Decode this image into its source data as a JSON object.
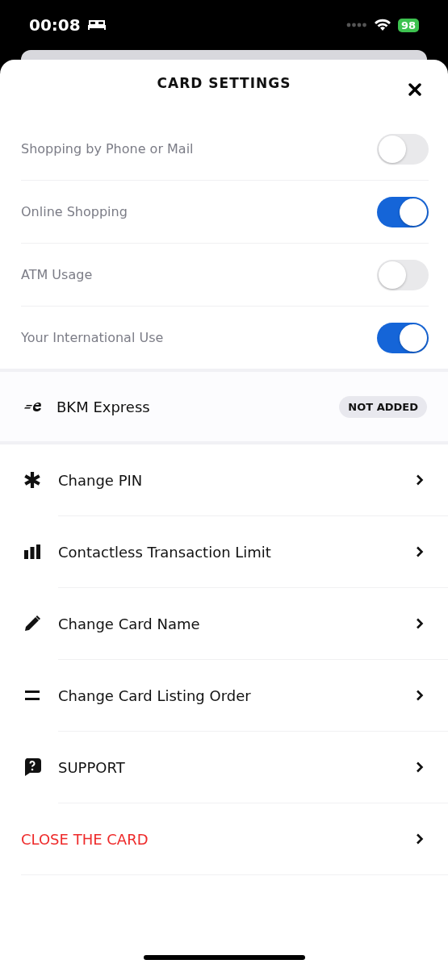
{
  "status_bar": {
    "time": "00:08",
    "battery": "98"
  },
  "title": "CARD SETTINGS",
  "toggles": [
    {
      "label": "Shopping by Phone or Mail",
      "on": false
    },
    {
      "label": "Online Shopping",
      "on": true
    },
    {
      "label": "ATM Usage",
      "on": false
    },
    {
      "label": "Your International Use",
      "on": true
    }
  ],
  "bkm": {
    "label": "BKM Express",
    "badge": "NOT ADDED"
  },
  "menu": [
    {
      "label": "Change PIN",
      "kind": "link"
    },
    {
      "label": "Contactless Transaction Limit",
      "kind": "link"
    },
    {
      "label": "Change Card Name",
      "kind": "link"
    },
    {
      "label": "Change Card Listing Order",
      "kind": "link"
    },
    {
      "label": "SUPPORT",
      "kind": "link"
    },
    {
      "label": "CLOSE THE CARD",
      "kind": "danger"
    }
  ]
}
